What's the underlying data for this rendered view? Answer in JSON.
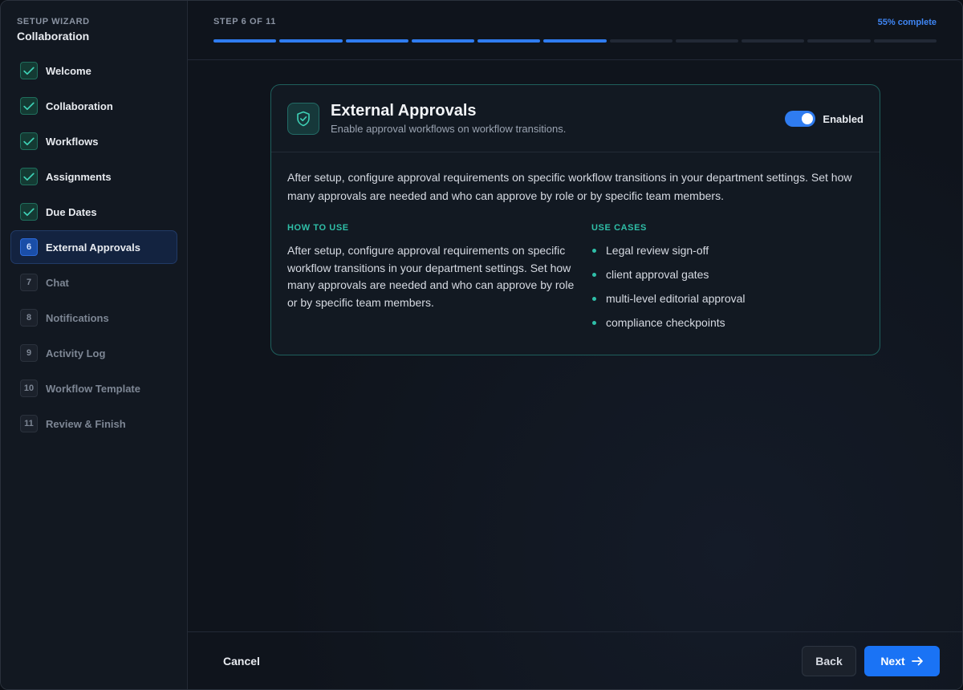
{
  "sidebar": {
    "kicker": "SETUP WIZARD",
    "title": "Collaboration",
    "steps": [
      {
        "num": "1",
        "label": "Welcome",
        "status": "done"
      },
      {
        "num": "2",
        "label": "Collaboration",
        "status": "done"
      },
      {
        "num": "3",
        "label": "Workflows",
        "status": "done"
      },
      {
        "num": "4",
        "label": "Assignments",
        "status": "done"
      },
      {
        "num": "5",
        "label": "Due Dates",
        "status": "done"
      },
      {
        "num": "6",
        "label": "External Approvals",
        "status": "active"
      },
      {
        "num": "7",
        "label": "Chat",
        "status": "todo"
      },
      {
        "num": "8",
        "label": "Notifications",
        "status": "todo"
      },
      {
        "num": "9",
        "label": "Activity Log",
        "status": "todo"
      },
      {
        "num": "10",
        "label": "Workflow Template",
        "status": "todo"
      },
      {
        "num": "11",
        "label": "Review & Finish",
        "status": "todo"
      }
    ]
  },
  "header": {
    "step_text": "STEP 6 OF 11",
    "percent_text": "55% complete",
    "current_step": 6,
    "total_steps": 11
  },
  "feature": {
    "icon": "shield-check-icon",
    "title": "External Approvals",
    "subtitle": "Enable approval workflows on workflow transitions.",
    "toggle_label": "Enabled",
    "enabled": true,
    "intro": "After setup, configure approval requirements on specific workflow transitions in your department settings. Set how many approvals are needed and who can approve by role or by specific team members.",
    "how_to_heading": "HOW TO USE",
    "how_to_text": "After setup, configure approval requirements on specific workflow transitions in your department settings. Set how many approvals are needed and who can approve by role or by specific team members.",
    "use_cases_heading": "USE CASES",
    "use_cases": [
      "Legal review sign-off",
      "client approval gates",
      "multi-level editorial approval",
      "compliance checkpoints"
    ]
  },
  "footer": {
    "cancel_label": "Cancel",
    "back_label": "Back",
    "next_label": "Next"
  },
  "colors": {
    "accent": "#2f7cf0",
    "teal": "#2fbfa8"
  }
}
